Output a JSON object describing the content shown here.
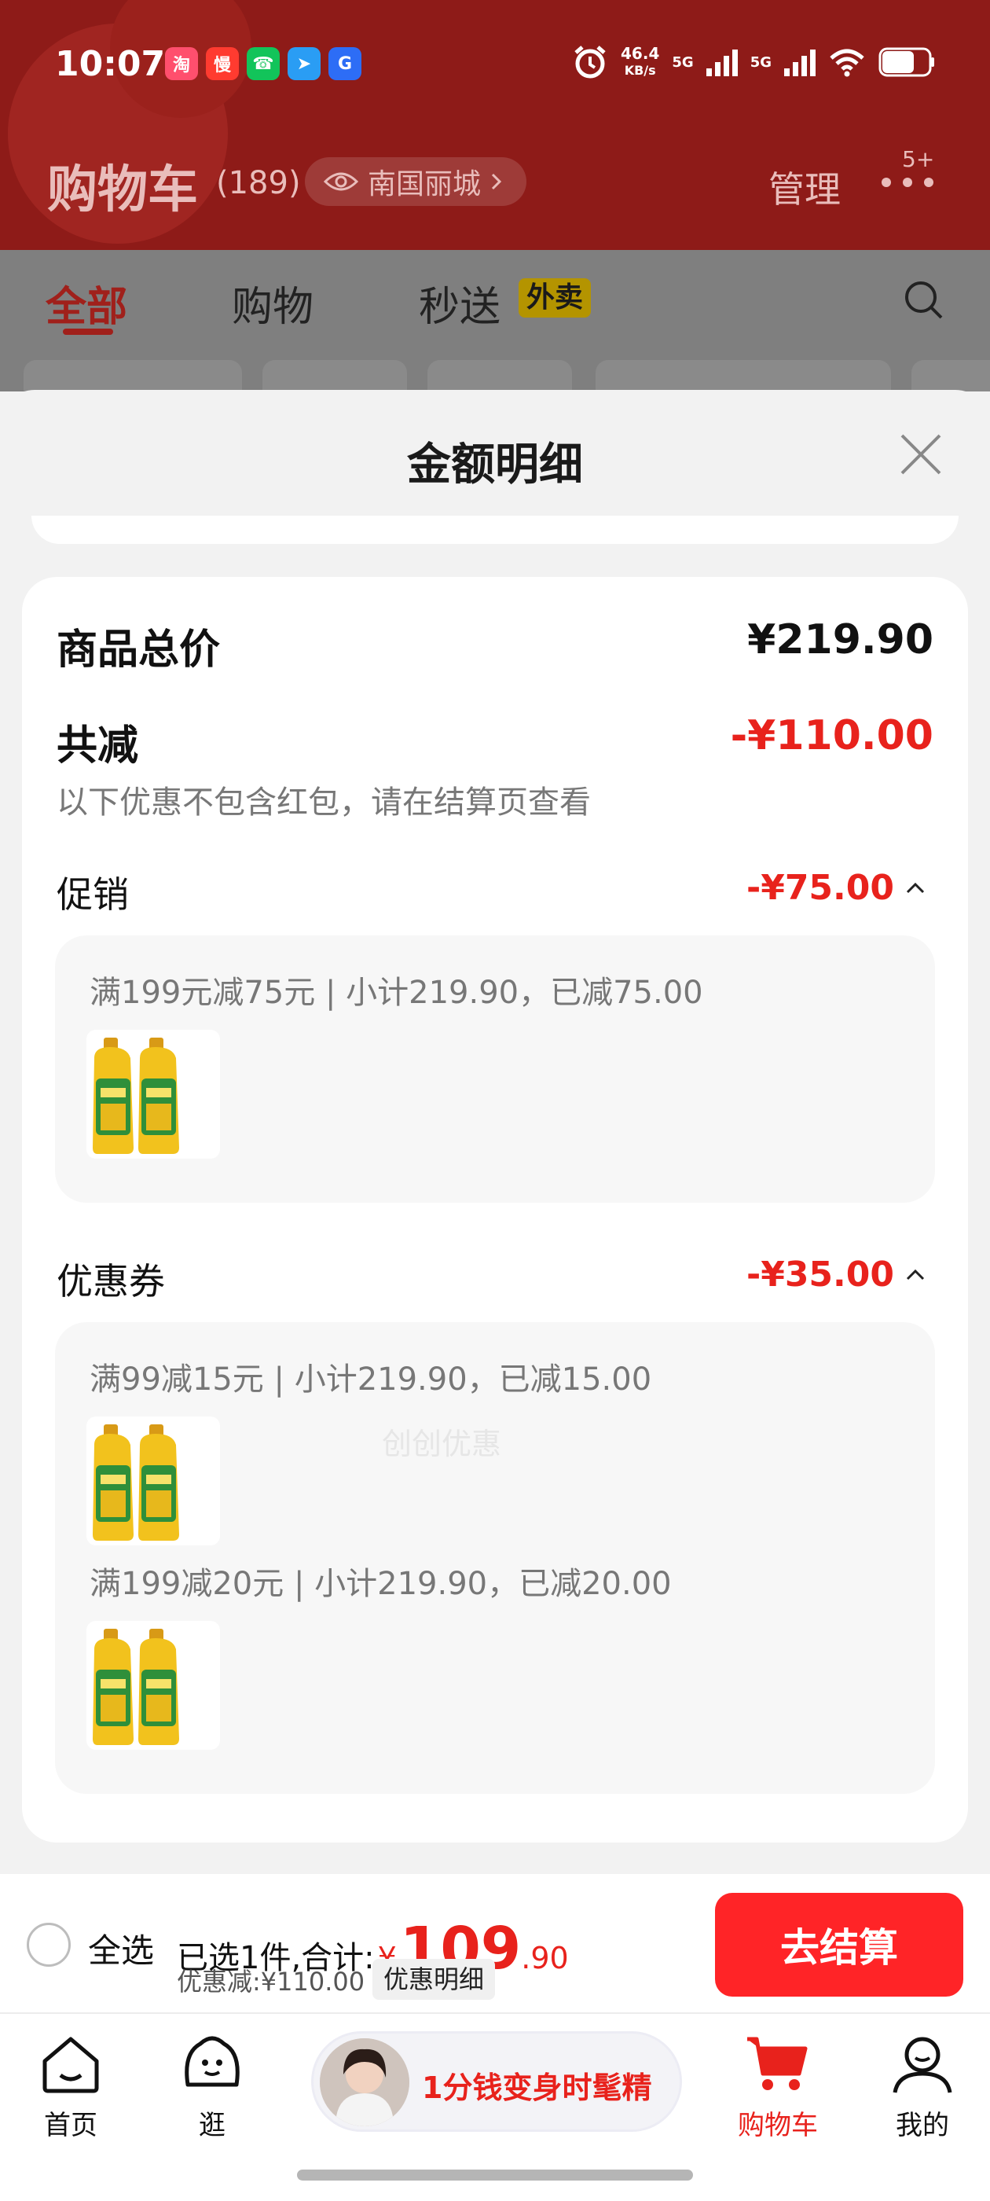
{
  "status_bar": {
    "time": "10:07",
    "net_speed_value": "46.4",
    "net_speed_unit": "KB/s",
    "signal_1": "5G",
    "signal_2": "5G",
    "app_icons": [
      "shopping-app-icon",
      "deal-app-icon",
      "phone-app-icon",
      "telegram-app-icon",
      "browser-app-icon"
    ]
  },
  "header": {
    "title": "购物车",
    "count": "(189)",
    "location": "南国丽城",
    "manage": "管理",
    "more_badge": "5+"
  },
  "tabs": [
    {
      "label": "全部",
      "active": true
    },
    {
      "label": "购物",
      "active": false
    },
    {
      "label": "秒送",
      "active": false,
      "tag": "外卖"
    }
  ],
  "sheet": {
    "title": "金额明细",
    "total_label": "商品总价",
    "total_value": "¥219.90",
    "reduce_label": "共减",
    "reduce_value": "-¥110.00",
    "reduce_note": "以下优惠不包含红包，请在结算页查看",
    "sections": [
      {
        "label": "促销",
        "amount": "-¥75.00",
        "items": [
          {
            "text": "满199元减75元 | 小计219.90，已减75.00"
          }
        ]
      },
      {
        "label": "优惠券",
        "amount": "-¥35.00",
        "items": [
          {
            "text": "满99减15元 | 小计219.90，已减15.00"
          },
          {
            "text": "满199减20元 | 小计219.90，已减20.00"
          }
        ]
      }
    ],
    "watermark": "创创优惠"
  },
  "checkout": {
    "select_all": "全选",
    "selected_prefix": "已选1件,合计:",
    "currency": "¥",
    "price_int": "109",
    "price_dec": ".90",
    "discount_text": "优惠减:¥110.00",
    "detail_button": "优惠明细",
    "checkout_button": "去结算"
  },
  "tabbar": {
    "home": "首页",
    "browse": "逛",
    "promo": "1分钱变身时髦精",
    "cart": "购物车",
    "me": "我的"
  },
  "colors": {
    "accent_red": "#e8221c",
    "header_red": "#8e1b18",
    "checkout_red": "#ff2427"
  }
}
